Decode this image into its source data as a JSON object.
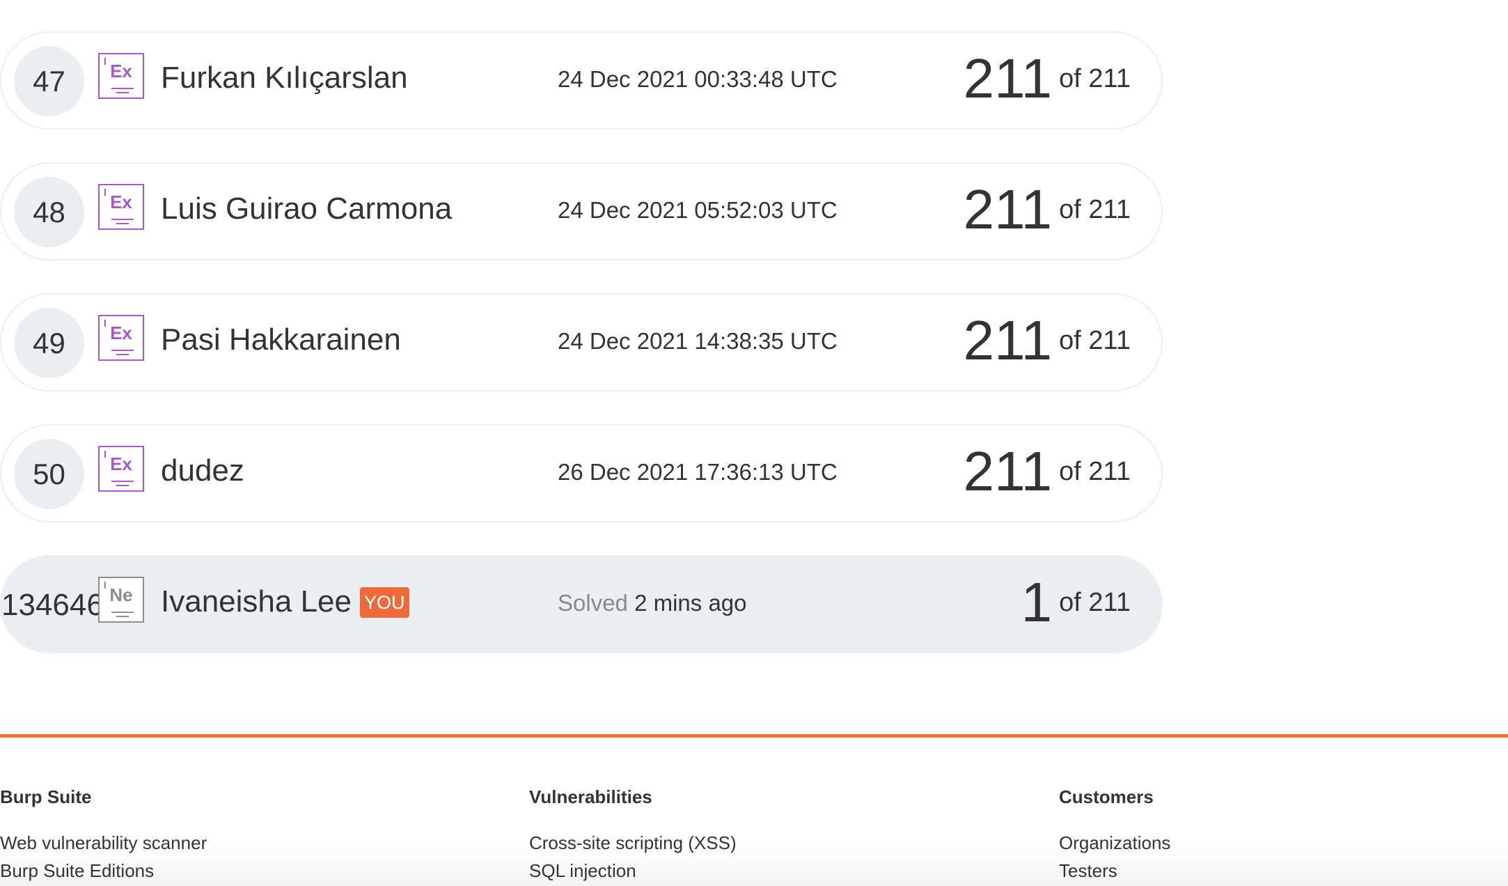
{
  "leaderboard": {
    "rows": [
      {
        "rank": "47",
        "level": "Ex",
        "name": "Furkan Kılıçarslan",
        "date": "24 Dec 2021 00:33:48 UTC",
        "solved": "211",
        "total": "of 211"
      },
      {
        "rank": "48",
        "level": "Ex",
        "name": "Luis Guirao Carmona",
        "date": "24 Dec 2021 05:52:03 UTC",
        "solved": "211",
        "total": "of 211"
      },
      {
        "rank": "49",
        "level": "Ex",
        "name": "Pasi Hakkarainen",
        "date": "24 Dec 2021 14:38:35 UTC",
        "solved": "211",
        "total": "of 211"
      },
      {
        "rank": "50",
        "level": "Ex",
        "name": "dudez",
        "date": "26 Dec 2021 17:36:13 UTC",
        "solved": "211",
        "total": "of 211"
      }
    ],
    "you": {
      "rank": "134646",
      "level": "Ne",
      "name": "Ivaneisha Lee",
      "you_label": "YOU",
      "solved_prefix": "Solved",
      "solved_when": "2 mins ago",
      "solved": "1",
      "total": "of 211"
    }
  },
  "footer": {
    "columns": [
      {
        "heading": "Burp Suite",
        "links": [
          "Web vulnerability scanner",
          "Burp Suite Editions"
        ]
      },
      {
        "heading": "Vulnerabilities",
        "links": [
          "Cross-site scripting (XSS)",
          "SQL injection"
        ]
      },
      {
        "heading": "Customers",
        "links": [
          "Organizations",
          "Testers"
        ]
      }
    ]
  },
  "colors": {
    "accent": "#e8743b",
    "you_badge": "#ec6b3a",
    "expert_level": "#a45bc1",
    "novice_level": "#8e8e8e",
    "row_highlight": "#ebeef1"
  },
  "icons": {
    "expert": "expert-level-icon",
    "novice": "novice-level-icon"
  }
}
